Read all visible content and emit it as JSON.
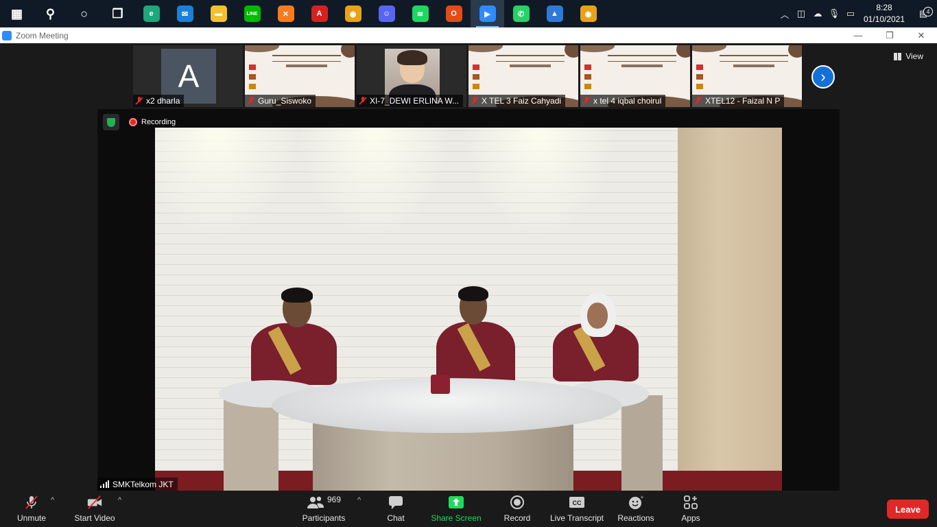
{
  "taskbar": {
    "apps": [
      {
        "name": "start-icon",
        "glyph": "▦",
        "color": "#ffffff"
      },
      {
        "name": "search-icon",
        "glyph": "⚲",
        "color": "#ffffff"
      },
      {
        "name": "cortana-icon",
        "glyph": "○",
        "color": "#ffffff"
      },
      {
        "name": "task-view-icon",
        "glyph": "❐",
        "color": "#ffffff"
      },
      {
        "name": "edge-icon",
        "glyph": "e",
        "color": "#1fa67a"
      },
      {
        "name": "mail-icon",
        "glyph": "✉",
        "color": "#1d80d6"
      },
      {
        "name": "file-explorer-icon",
        "glyph": "▬",
        "color": "#f2c12e"
      },
      {
        "name": "line-icon",
        "glyph": "LINE",
        "color": "#00b900"
      },
      {
        "name": "xampp-icon",
        "glyph": "✕",
        "color": "#f57c20"
      },
      {
        "name": "acrobat-icon",
        "glyph": "A",
        "color": "#d4231f"
      },
      {
        "name": "chrome-icon",
        "glyph": "◉",
        "color": "#e8a21a"
      },
      {
        "name": "discord-icon",
        "glyph": "☺",
        "color": "#5865f2"
      },
      {
        "name": "spotify-icon",
        "glyph": "≋",
        "color": "#1ed760"
      },
      {
        "name": "office-icon",
        "glyph": "O",
        "color": "#e64a19"
      },
      {
        "name": "zoom-icon",
        "glyph": "▶",
        "color": "#2d8cff",
        "active": true
      },
      {
        "name": "whatsapp-icon",
        "glyph": "✆",
        "color": "#25d366"
      },
      {
        "name": "photos-icon",
        "glyph": "▲",
        "color": "#2f7ad6"
      },
      {
        "name": "chrome-profile-icon",
        "glyph": "◉",
        "color": "#e8a21a"
      }
    ],
    "tray": {
      "time": "8:28",
      "date": "01/10/2021",
      "notifications": "4"
    }
  },
  "titlebar": {
    "title": "Zoom Meeting"
  },
  "meeting": {
    "view_label": "View",
    "thumbnails": [
      {
        "label": "x2 dharla",
        "type": "avatar",
        "initial": "A"
      },
      {
        "label": "Guru_Siswoko",
        "type": "slide"
      },
      {
        "label": "XI-7_DEWI ERLINA W...",
        "type": "photo"
      },
      {
        "label": "X TEL 3 Faiz Cahyadi",
        "type": "slide"
      },
      {
        "label": "x tel 4 iqbal choirul",
        "type": "slide"
      },
      {
        "label": "XTEL12 - Faizal N P",
        "type": "slide"
      }
    ],
    "recording_label": "Recording",
    "speaker_name": "SMKTelkom JKT"
  },
  "toolbar": {
    "unmute": "Unmute",
    "start_video": "Start Video",
    "participants": "Participants",
    "participants_count": "969",
    "chat": "Chat",
    "share_screen": "Share Screen",
    "record": "Record",
    "live_transcript": "Live Transcript",
    "reactions": "Reactions",
    "apps": "Apps",
    "leave": "Leave"
  }
}
